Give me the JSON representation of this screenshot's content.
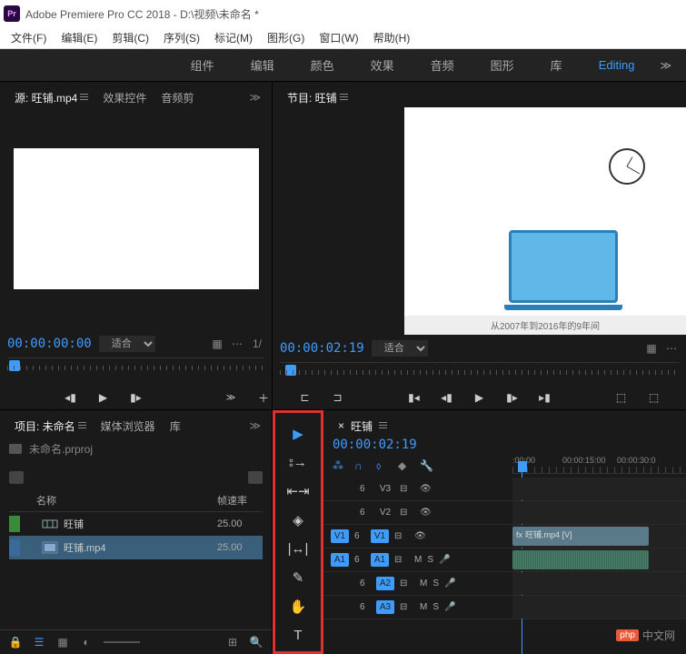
{
  "titlebar": {
    "icon": "Pr",
    "title": "Adobe Premiere Pro CC 2018 - D:\\视频\\未命名 *"
  },
  "menubar": [
    "文件(F)",
    "编辑(E)",
    "剪辑(C)",
    "序列(S)",
    "标记(M)",
    "图形(G)",
    "窗口(W)",
    "帮助(H)"
  ],
  "workspaces": [
    "组件",
    "编辑",
    "颜色",
    "效果",
    "音频",
    "图形",
    "库",
    "Editing"
  ],
  "active_workspace": "Editing",
  "source": {
    "tab_label": "源: 旺铺.mp4",
    "tabs": [
      "源: 旺铺.mp4",
      "效果控件",
      "音频剪"
    ],
    "timecode": "00:00:00:00",
    "fit_label": "适合",
    "page": "1/"
  },
  "program": {
    "tab_label": "节目: 旺铺",
    "timecode": "00:00:02:19",
    "fit_label": "适合",
    "caption": "从2007年到2016年的9年间"
  },
  "project": {
    "tabs": [
      "项目: 未命名",
      "媒体浏览器",
      "库"
    ],
    "filename": "未命名.prproj",
    "columns": {
      "name": "名称",
      "fps": "帧速率"
    },
    "items": [
      {
        "name": "旺铺",
        "fps": "25.00",
        "type": "sequence",
        "color": "green"
      },
      {
        "name": "旺铺.mp4",
        "fps": "25.00",
        "type": "clip",
        "color": "blue"
      }
    ]
  },
  "tools": [
    "selection",
    "track-select",
    "ripple-edit",
    "razor",
    "slip",
    "pen",
    "hand",
    "type"
  ],
  "timeline": {
    "tab_label": "旺铺",
    "timecode": "00:00:02:19",
    "ruler_labels": [
      {
        "text": ":00:00",
        "pos": 0
      },
      {
        "text": "00:00:15:00",
        "pos": 55
      },
      {
        "text": "00:00:30:0",
        "pos": 115
      }
    ],
    "tracks": {
      "v3": {
        "label1": "6",
        "label2": "V3"
      },
      "v2": {
        "label1": "6",
        "label2": "V2"
      },
      "v1": {
        "label1": "V1",
        "label2": "6",
        "label3": "V1",
        "clip": "旺铺.mp4 [V]"
      },
      "a1": {
        "label1": "A1",
        "label2": "6",
        "label3": "A1",
        "m": "M",
        "s": "S"
      },
      "a2": {
        "label2": "6",
        "label3": "A2",
        "m": "M",
        "s": "S"
      },
      "a3": {
        "label2": "6",
        "label3": "A3",
        "m": "M",
        "s": "S"
      }
    }
  },
  "watermark": {
    "icon": "php",
    "text": "中文网"
  }
}
